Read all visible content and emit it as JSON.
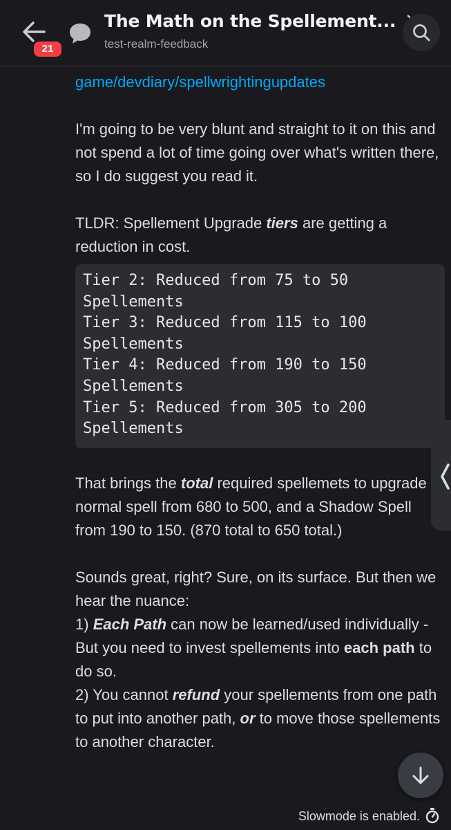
{
  "header": {
    "badge_count": "21",
    "title": "The Math on the Spellement...",
    "subtitle": "test-realm-feedback"
  },
  "message": {
    "link_text": "game/devdiary/spellwrightingupdates",
    "p1": "I'm going to be very blunt and straight to it on this and not spend a lot of time going over what's written there, so I do suggest you read it.",
    "p2_a": "TLDR: Spellement Upgrade ",
    "p2_b": "tiers",
    "p2_c": " are getting a reduction in cost.",
    "code_block": "Tier 2: Reduced from 75 to 50\nSpellements\nTier 3: Reduced from 115 to 100\nSpellements\nTier 4: Reduced from 190 to 150\nSpellements\nTier 5: Reduced from 305 to 200\nSpellements",
    "p3_a": "That brings the ",
    "p3_b": "total",
    "p3_c": " required spellemets to upgrade a normal spell from 680 to 500, and a Shadow Spell from 190 to 150. (870 total to 650 total.)",
    "p4_line1": "Sounds great, right? Sure, on its surface. But then we hear the nuance:",
    "p4_item1_a": "1) ",
    "p4_item1_b": "Each Path",
    "p4_item1_c": " can now be learned/used individually - But you need to invest spellements into ",
    "p4_item1_d": "each path",
    "p4_item1_e": " to do so.",
    "p4_item2_a": "2) You cannot ",
    "p4_item2_b": "refund",
    "p4_item2_c": " your spellements from one path to put into another path, ",
    "p4_item2_d": "or",
    "p4_item2_e": " to move those spellements to another character."
  },
  "footer": {
    "slowmode_text": "Slowmode is enabled."
  },
  "icons": {
    "back": "arrow-left-icon",
    "thread": "chat-bubble-icon",
    "search": "search-icon",
    "scroll": "arrow-down-icon",
    "timer": "stopwatch-icon"
  },
  "colors": {
    "background": "#1a1a1e",
    "link": "#00a8fc",
    "badge": "#f23f43",
    "code_bg": "#2b2d31"
  }
}
